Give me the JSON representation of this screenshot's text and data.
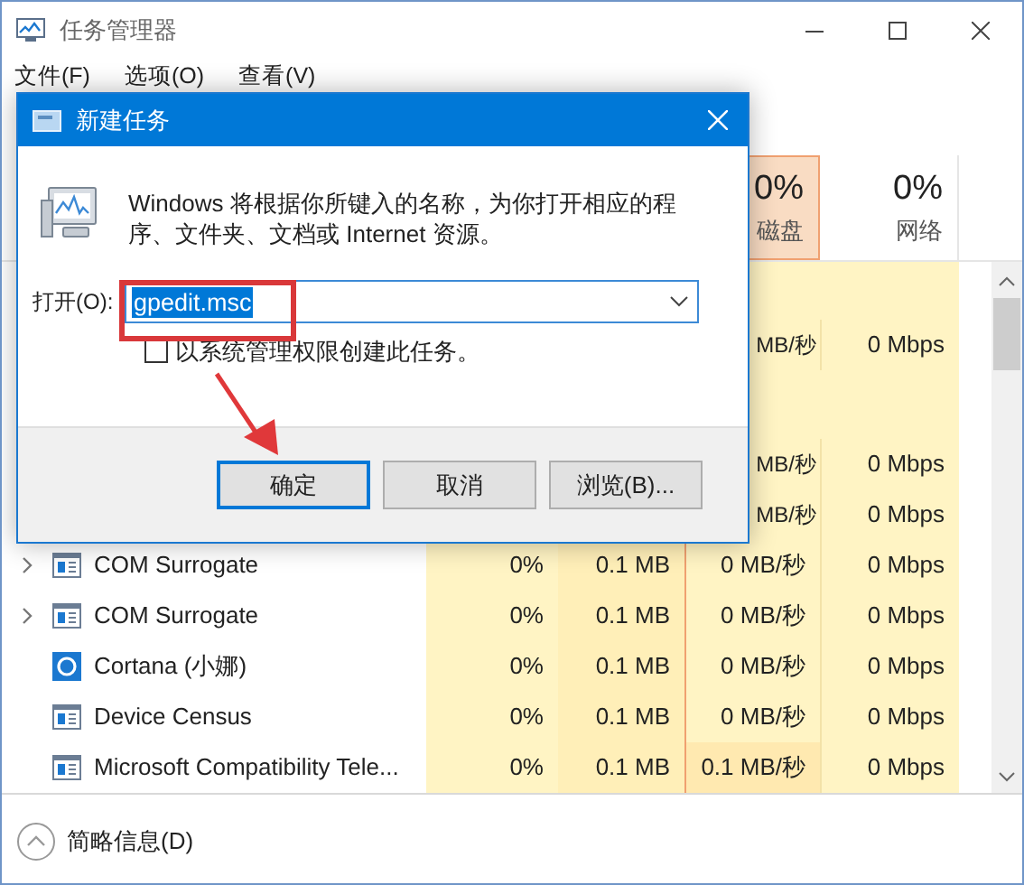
{
  "window": {
    "title": "任务管理器"
  },
  "menu": [
    "文件(F)",
    "选项(O)",
    "查看(V)"
  ],
  "header": {
    "disk": {
      "percent": "0%",
      "label": "磁盘",
      "highlighted": true
    },
    "network": {
      "percent": "0%",
      "label": "网络",
      "highlighted": false
    }
  },
  "rows": [
    {
      "kind": "partial",
      "disk": "MB/秒",
      "network": "0 Mbps"
    },
    {
      "kind": "partial",
      "disk": "MB/秒",
      "network": "0 Mbps"
    },
    {
      "kind": "partial",
      "disk": "MB/秒",
      "network": "0 Mbps"
    },
    {
      "kind": "service",
      "expandable": true,
      "name": "COM Surrogate",
      "cpu": "0%",
      "memory": "0.1 MB",
      "disk": "0 MB/秒",
      "network": "0 Mbps"
    },
    {
      "kind": "service",
      "expandable": true,
      "name": "COM Surrogate",
      "cpu": "0%",
      "memory": "0.1 MB",
      "disk": "0 MB/秒",
      "network": "0 Mbps"
    },
    {
      "kind": "app",
      "expandable": false,
      "name": "Cortana (小娜)",
      "cpu": "0%",
      "memory": "0.1 MB",
      "disk": "0 MB/秒",
      "network": "0 Mbps"
    },
    {
      "kind": "service",
      "expandable": false,
      "name": "Device Census",
      "cpu": "0%",
      "memory": "0.1 MB",
      "disk": "0 MB/秒",
      "network": "0 Mbps"
    },
    {
      "kind": "service",
      "expandable": false,
      "name": "Microsoft Compatibility Tele...",
      "cpu": "0%",
      "memory": "0.1 MB",
      "disk": "0.1 MB/秒",
      "network": "0 Mbps"
    }
  ],
  "footer": {
    "label": "简略信息(D)"
  },
  "dialog": {
    "title": "新建任务",
    "message": "Windows 将根据你所键入的名称，为你打开相应的程序、文件夹、文档或 Internet 资源。",
    "open_label": "打开(O):",
    "input": {
      "value": "gpedit.msc",
      "text_selected": true
    },
    "checkbox": {
      "label": "以系统管理权限创建此任务。",
      "checked": false
    },
    "buttons": [
      {
        "label": "确定",
        "focused": true
      },
      {
        "label": "取消",
        "focused": false
      },
      {
        "label": "浏览(B)...",
        "focused": false
      }
    ]
  }
}
